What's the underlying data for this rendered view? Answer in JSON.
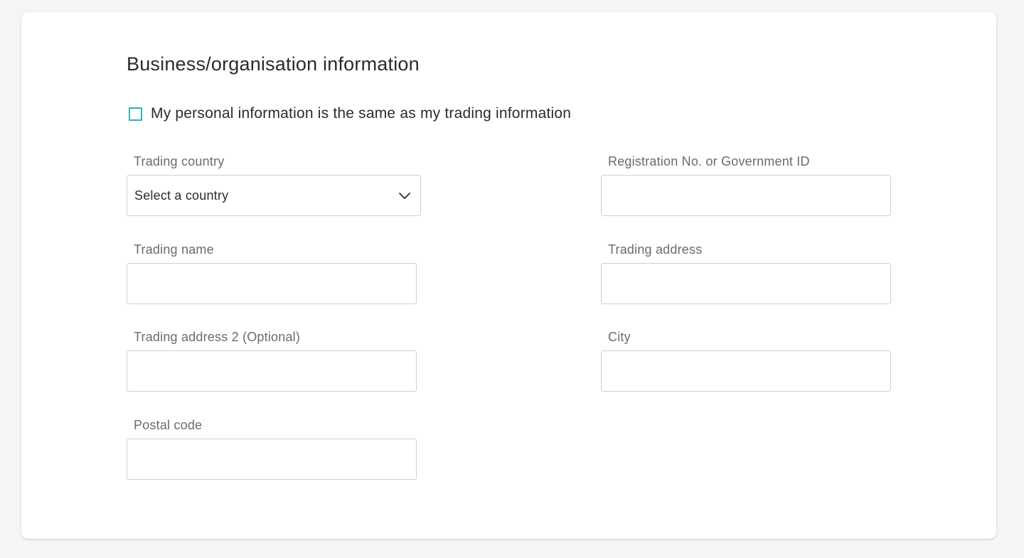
{
  "section": {
    "title": "Business/organisation information"
  },
  "same_info_checkbox": {
    "label": "My personal information is the same as my trading information",
    "checked": false
  },
  "fields": {
    "trading_country": {
      "label": "Trading country",
      "selected": "Select a country"
    },
    "registration_id": {
      "label": "Registration No. or Government ID",
      "value": ""
    },
    "trading_name": {
      "label": "Trading name",
      "value": ""
    },
    "trading_address": {
      "label": "Trading address",
      "value": ""
    },
    "trading_address_2": {
      "label": "Trading address 2 (Optional)",
      "value": ""
    },
    "city": {
      "label": "City",
      "value": ""
    },
    "postal_code": {
      "label": "Postal code",
      "value": ""
    }
  },
  "icons": {
    "select_chevron": "chevron-down-icon"
  },
  "colors": {
    "checkbox_accent": "#2bb5b0",
    "page_background": "#f5f5f5",
    "card_background": "#ffffff"
  }
}
